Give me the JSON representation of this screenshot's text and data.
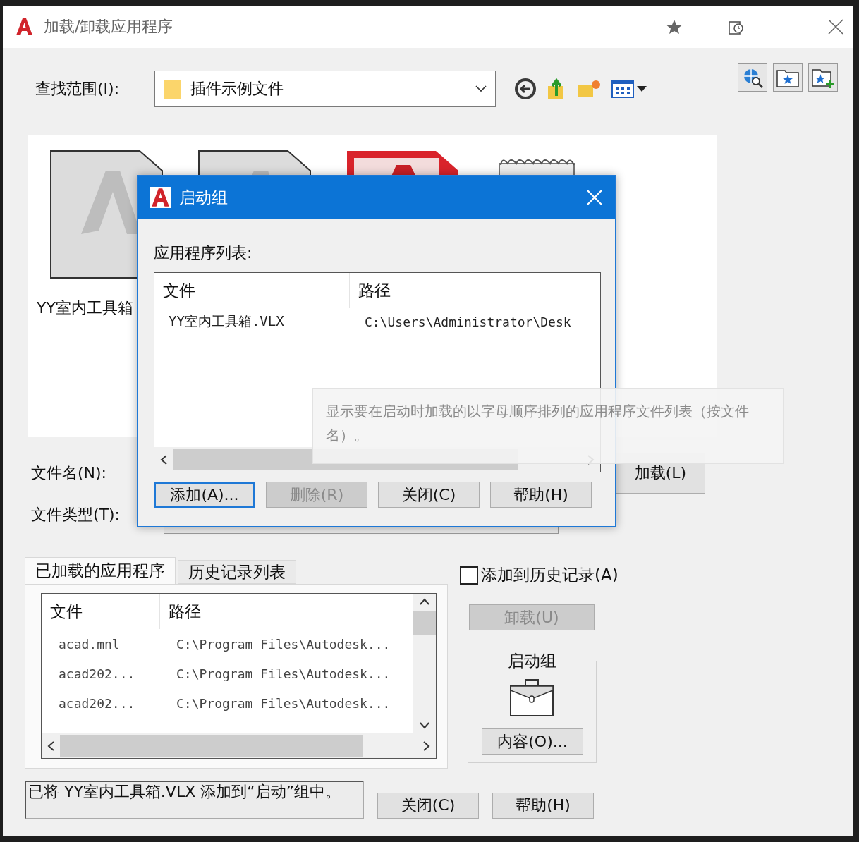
{
  "window": {
    "title": "加载/卸载应用程序"
  },
  "look_in": {
    "label": "查找范围(I):",
    "value": "插件示例文件"
  },
  "files": [
    {
      "kind": "autocad",
      "name": "YY室内工具箱"
    },
    {
      "kind": "autocad"
    },
    {
      "kind": "red"
    },
    {
      "kind": "notebook"
    }
  ],
  "file_name": {
    "label": "文件名(N):"
  },
  "load_button": "加载(L)",
  "file_type": {
    "label": "文件类型(T):"
  },
  "tabs": [
    {
      "label": "已加载的应用程序",
      "selected": true
    },
    {
      "label": "历史记录列表",
      "selected": false
    }
  ],
  "loaded_table": {
    "columns": [
      "文件",
      "路径"
    ],
    "rows": [
      [
        "acad.mnl",
        "C:\\Program Files\\Autodesk..."
      ],
      [
        "acad202...",
        "C:\\Program Files\\Autodesk..."
      ],
      [
        "acad202...",
        "C:\\Program Files\\Autodesk..."
      ]
    ]
  },
  "add_to_history": {
    "label": "添加到历史记录(A)",
    "checked": false
  },
  "unload_button": {
    "label": "卸载(U)",
    "disabled": true
  },
  "startup_group": {
    "title": "启动组",
    "button": "内容(O)..."
  },
  "status": "已将 YY室内工具箱.VLX 添加到“启动”组中。",
  "buttons": [
    "关闭(C)",
    "帮助(H)"
  ],
  "startup_dialog": {
    "title": "启动组",
    "list_label": "应用程序列表:",
    "columns": [
      "文件",
      "路径"
    ],
    "rows": [
      [
        "YY室内工具箱.VLX",
        "C:\\Users\\Administrator\\Desk"
      ]
    ],
    "buttons": [
      {
        "label": "添加(A)...",
        "disabled": false,
        "focused": true
      },
      {
        "label": "删除(R)",
        "disabled": true,
        "focused": false
      },
      {
        "label": "关闭(C)",
        "disabled": false,
        "focused": false
      },
      {
        "label": "帮助(H)",
        "disabled": false,
        "focused": false
      }
    ]
  },
  "tooltip": "显示要在启动时加载的以字母顺序排列的应用程序文件列表（按文件名）。"
}
